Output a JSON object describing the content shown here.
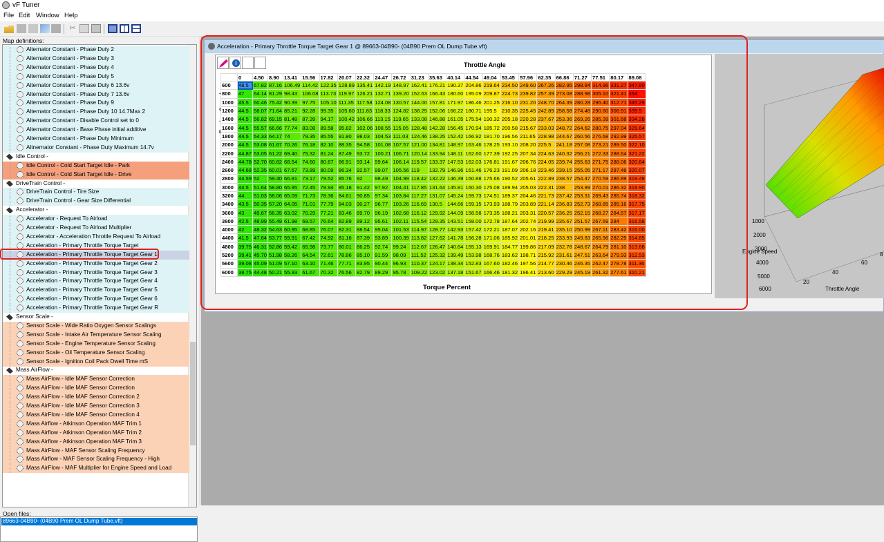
{
  "app": {
    "title": "vF Tuner"
  },
  "menu": [
    "File",
    "Edit",
    "Window",
    "Help"
  ],
  "left": {
    "map_label": "Map definitions:",
    "open_label": "Open files:",
    "open_file": "89663-04B90- (04B90 Prem OL Dump Tube.vft)"
  },
  "tree": [
    {
      "t": "Alternator Constant - Phase Duty 2",
      "c": "alt",
      "k": "item"
    },
    {
      "t": "Alternator Constant - Phase Duty 3",
      "c": "alt",
      "k": "item"
    },
    {
      "t": "Alternator Constant - Phase Duty 4",
      "c": "alt",
      "k": "item"
    },
    {
      "t": "Alternator Constant - Phase Duty 5",
      "c": "alt",
      "k": "item"
    },
    {
      "t": "Alternator Constant - Phase Duty 6 13.6v",
      "c": "alt",
      "k": "item"
    },
    {
      "t": "Alternator Constant - Phase Duty 7 13.6v",
      "c": "alt",
      "k": "item"
    },
    {
      "t": "Alternator Constant - Phase Duty 9",
      "c": "alt",
      "k": "item"
    },
    {
      "t": "Alternator Constant - Phase Duty 10 14.7Max 2",
      "c": "alt",
      "k": "item"
    },
    {
      "t": "Alternator Constant - Disable Control set to 0",
      "c": "alt",
      "k": "item"
    },
    {
      "t": "Alternator Constant - Base Phase initial additive",
      "c": "alt",
      "k": "item"
    },
    {
      "t": "Alternator Constant - Phase Duty Minimum",
      "c": "alt",
      "k": "item"
    },
    {
      "t": "Altnernator Constant - Phase Duty Maximum 14.7v",
      "c": "alt",
      "k": "item"
    },
    {
      "t": "Idle Control -",
      "c": "",
      "k": "folder"
    },
    {
      "t": "Idle Control - Cold Start Target Idle - Park",
      "c": "idle",
      "k": "item"
    },
    {
      "t": "Idle Control - Cold Start Target Idle - Drive",
      "c": "idle",
      "k": "item"
    },
    {
      "t": "DriveTrain Control -",
      "c": "",
      "k": "folder"
    },
    {
      "t": "DriveTrain Control - Tire Size",
      "c": "drive",
      "k": "item"
    },
    {
      "t": "DriveTrain Control - Gear Size Differential",
      "c": "drive",
      "k": "item"
    },
    {
      "t": "Accelerator -",
      "c": "",
      "k": "folder"
    },
    {
      "t": "Accelerator - Request To Airload",
      "c": "accel",
      "k": "item"
    },
    {
      "t": "Accelerator - Request To Airload Multiplier",
      "c": "accel",
      "k": "item"
    },
    {
      "t": "Accelerator - Acceleration Throttle Request To Airload",
      "c": "accel",
      "k": "item"
    },
    {
      "t": "Acceleration - Primary Throttle Torque Target",
      "c": "accel",
      "k": "item"
    },
    {
      "t": "Acceleration - Primary Throttle Torque Target Gear 1",
      "c": "sel",
      "k": "item"
    },
    {
      "t": "Acceleration - Primary Throttle Torque Target Gear 2",
      "c": "accel",
      "k": "item"
    },
    {
      "t": "Acceleration - Primary Throttle Torque Target Gear 3",
      "c": "accel",
      "k": "item"
    },
    {
      "t": "Acceleration - Primary Throttle Torque Target Gear 4",
      "c": "accel",
      "k": "item"
    },
    {
      "t": "Acceleration - Primary Throttle Torque Target Gear 5",
      "c": "accel",
      "k": "item"
    },
    {
      "t": "Acceleration - Primary Throttle Torque Target Gear 6",
      "c": "accel",
      "k": "item"
    },
    {
      "t": "Acceleration - Primary Throttle Torque Target Gear R",
      "c": "accel",
      "k": "item"
    },
    {
      "t": "Sensor Scale -",
      "c": "",
      "k": "folder"
    },
    {
      "t": "Sensor Scale - Wide Ratio Oxygen Sensor Scalings",
      "c": "sensor",
      "k": "item"
    },
    {
      "t": "Sensor Scale - Intake Air Temperature Sensor Scaling",
      "c": "sensor",
      "k": "item"
    },
    {
      "t": "Sensor Scale - Engine Temperature Sensor Scaling",
      "c": "sensor",
      "k": "item"
    },
    {
      "t": "Sensor Scale - Oil Temperature Sensor Scaling",
      "c": "sensor",
      "k": "item"
    },
    {
      "t": "Sensor Scale - Ignition Coil Pack Dwell Time mS",
      "c": "sensor",
      "k": "item"
    },
    {
      "t": "Mass AirFlow -",
      "c": "",
      "k": "folder"
    },
    {
      "t": "Mass AirFlow - Idle MAF Sensor Correction",
      "c": "maf",
      "k": "item"
    },
    {
      "t": "Mass AirFlow - Idle MAF Sensor Correction",
      "c": "maf",
      "k": "item"
    },
    {
      "t": "Mass AirFlow - Idle MAF Sensor Correction 2",
      "c": "maf",
      "k": "item"
    },
    {
      "t": "Mass AirFlow - Idle MAF Sensor Correction 3",
      "c": "maf",
      "k": "item"
    },
    {
      "t": "Mass AirFlow - Idle MAF Sensor Correction 4",
      "c": "maf",
      "k": "item"
    },
    {
      "t": "Mass Airflow - Atkinson Operation MAF Trim 1",
      "c": "maf",
      "k": "item"
    },
    {
      "t": "Mass Airflow - Atkinson Operation MAF Trim 2",
      "c": "maf",
      "k": "item"
    },
    {
      "t": "Mass Airflow - Atkinson Operation MAF Trim 3",
      "c": "maf",
      "k": "item"
    },
    {
      "t": "Mass AirFlow - MAF Sensor Scaling Frequency",
      "c": "maf",
      "k": "item"
    },
    {
      "t": "Mass Airflow - MAF Sensor Scaling Frequency - High",
      "c": "maf",
      "k": "item"
    },
    {
      "t": "Mass AirFlow - MAF Multiplier for Engine Speed and Load",
      "c": "maf",
      "k": "item"
    }
  ],
  "editor": {
    "title": "Acceleration - Primary Throttle Torque Target Gear 1 @ 89663-04B90- (04B90 Prem OL Dump Tube.vft)",
    "x_title": "Throttle Angle",
    "y_title": "Engine Speed",
    "z_title": "Torque Percent",
    "info_glyph": "i",
    "cols": [
      "0",
      "4.50",
      "8.90",
      "13.41",
      "15.56",
      "17.82",
      "20.07",
      "22.32",
      "24.47",
      "26.72",
      "31.23",
      "35.63",
      "40.14",
      "44.54",
      "49.04",
      "53.45",
      "57.96",
      "62.35",
      "66.86",
      "71.27",
      "77.51",
      "80.17",
      "89.08"
    ],
    "rows": [
      {
        "rpm": "600",
        "v": [
          "48.5",
          "67.82",
          "87.16",
          "106.49",
          "114.42",
          "122.35",
          "128.89",
          "135.41",
          "142.19",
          "148.97",
          "162.41",
          "176.21",
          "190.37",
          "204.86",
          "219.64",
          "234.50",
          "249.60",
          "267.26",
          "282.95",
          "298.84",
          "314.96",
          "331.27",
          "347.80"
        ]
      },
      {
        "rpm": "800",
        "v": [
          "47",
          "64.14",
          "81.29",
          "98.43",
          "106.08",
          "113.73",
          "119.97",
          "126.21",
          "132.71",
          "139.20",
          "152.63",
          "166.43",
          "180.60",
          "195.09",
          "209.87",
          "224.73",
          "239.82",
          "257.39",
          "273.08",
          "288.98",
          "305.10",
          "321.41",
          "354"
        ]
      },
      {
        "rpm": "1000",
        "v": [
          "45.5",
          "60.46",
          "75.42",
          "90.39",
          "97.75",
          "105.10",
          "111.35",
          "117.58",
          "124.08",
          "130.57",
          "144.00",
          "157.81",
          "171.97",
          "186.46",
          "201.25",
          "216.10",
          "231.20",
          "248.70",
          "264.39",
          "280.28",
          "296.40",
          "312.71",
          "345.29"
        ]
      },
      {
        "rpm": "1200",
        "v": [
          "44.5",
          "58.07",
          "71.64",
          "85.21",
          "92.28",
          "99.35",
          "105.60",
          "111.83",
          "118.33",
          "124.82",
          "138.25",
          "152.06",
          "166.22",
          "180.71",
          "195.5",
          "210.35",
          "225.45",
          "242.89",
          "258.58",
          "274.48",
          "290.60",
          "306.91",
          "339.5"
        ]
      },
      {
        "rpm": "1400",
        "v": [
          "44.5",
          "56.82",
          "69.15",
          "81.48",
          "87.39",
          "94.17",
          "100.42",
          "106.66",
          "113.15",
          "119.65",
          "133.08",
          "146.88",
          "161.05",
          "175.54",
          "190.32",
          "205.18",
          "220.28",
          "237.67",
          "253.36",
          "269.26",
          "285.39",
          "301.68",
          "334.28"
        ]
      },
      {
        "rpm": "1600",
        "v": [
          "44.5",
          "55.57",
          "66.66",
          "77.74",
          "83.08",
          "89.58",
          "95.82",
          "102.06",
          "108.55",
          "115.05",
          "128.48",
          "142.28",
          "156.45",
          "170.94",
          "185.72",
          "200.58",
          "215.67",
          "233.03",
          "248.72",
          "264.62",
          "280.75",
          "297.04",
          "329.64"
        ]
      },
      {
        "rpm": "1800",
        "v": [
          "44.5",
          "54.33",
          "64.17",
          "74",
          "79.35",
          "85.55",
          "91.80",
          "98.03",
          "104.53",
          "111.03",
          "124.46",
          "138.25",
          "152.42",
          "166.92",
          "181.70",
          "196.56",
          "211.65",
          "228.98",
          "244.67",
          "260.56",
          "276.68",
          "292.99",
          "325.57"
        ]
      },
      {
        "rpm": "2000",
        "v": [
          "44.5",
          "53.08",
          "61.67",
          "70.26",
          "76.18",
          "82.10",
          "88.35",
          "94.58",
          "101.08",
          "107.57",
          "121.00",
          "134.81",
          "148.97",
          "163.46",
          "178.25",
          "193.10",
          "208.20",
          "225.5",
          "241.18",
          "257.08",
          "273.21",
          "289.50",
          "322.10"
        ]
      },
      {
        "rpm": "2200",
        "v": [
          "44.87",
          "53.05",
          "61.22",
          "69.40",
          "75.32",
          "81.24",
          "87.49",
          "93.72",
          "100.21",
          "106.71",
          "120.14",
          "133.94",
          "148.11",
          "162.60",
          "177.39",
          "192.25",
          "207.34",
          "224.63",
          "240.32",
          "256.21",
          "272.33",
          "288.64",
          "321.22"
        ]
      },
      {
        "rpm": "2400",
        "v": [
          "44.78",
          "52.70",
          "60.62",
          "68.54",
          "74.60",
          "80.67",
          "86.91",
          "93.14",
          "99.64",
          "106.14",
          "119.57",
          "133.37",
          "147.53",
          "162.03",
          "176.81",
          "191.67",
          "206.76",
          "224.05",
          "239.74",
          "255.63",
          "271.75",
          "288.06",
          "320.64"
        ]
      },
      {
        "rpm": "2600",
        "v": [
          "44.68",
          "52.35",
          "60.01",
          "67.67",
          "73.89",
          "80.09",
          "86.34",
          "92.57",
          "99.07",
          "105.56",
          "119",
          "132.79",
          "146.96",
          "161.46",
          "176.23",
          "191.09",
          "206.18",
          "223.46",
          "239.15",
          "255.05",
          "271.17",
          "287.48",
          "320.07"
        ]
      },
      {
        "rpm": "2800",
        "v": [
          "44.59",
          "52",
          "59.40",
          "66.81",
          "73.17",
          "79.52",
          "85.76",
          "92",
          "98.49",
          "104.99",
          "118.42",
          "132.22",
          "146.39",
          "160.88",
          "175.66",
          "190.52",
          "205.61",
          "222.89",
          "238.57",
          "254.47",
          "270.59",
          "286.89",
          "319.49"
        ]
      },
      {
        "rpm": "3000",
        "v": [
          "44.5",
          "51.64",
          "58.80",
          "65.95",
          "72.45",
          "78.94",
          "85.18",
          "91.42",
          "97.92",
          "104.41",
          "117.85",
          "131.64",
          "145.81",
          "160.30",
          "175.08",
          "189.94",
          "205.03",
          "222.31",
          "238",
          "253.89",
          "270.01",
          "286.32",
          "318.90"
        ]
      },
      {
        "rpm": "3200",
        "v": [
          "44",
          "51.03",
          "58.06",
          "65.09",
          "71.73",
          "78.36",
          "84.61",
          "90.85",
          "97.34",
          "103.84",
          "117.27",
          "131.07",
          "145.24",
          "159.73",
          "174.51",
          "189.37",
          "204.46",
          "221.73",
          "237.42",
          "253.31",
          "269.43",
          "285.74",
          "318.32"
        ]
      },
      {
        "rpm": "3400",
        "v": [
          "43.5",
          "50.35",
          "57.20",
          "64.05",
          "71.01",
          "77.79",
          "84.03",
          "90.27",
          "96.77",
          "103.26",
          "116.69",
          "130.5",
          "144.66",
          "159.15",
          "173.93",
          "188.79",
          "203.89",
          "221.14",
          "236.83",
          "252.73",
          "268.85",
          "285.16",
          "317.75"
        ]
      },
      {
        "rpm": "3600",
        "v": [
          "43",
          "49.67",
          "56.35",
          "63.02",
          "70.29",
          "77.21",
          "83.46",
          "89.70",
          "96.19",
          "102.68",
          "116.12",
          "129.92",
          "144.09",
          "158.58",
          "173.35",
          "188.21",
          "203.31",
          "220.57",
          "236.25",
          "252.15",
          "268.27",
          "284.57",
          "317.17"
        ]
      },
      {
        "rpm": "3800",
        "v": [
          "42.5",
          "48.99",
          "55.49",
          "61.98",
          "69.57",
          "76.64",
          "82.89",
          "89.12",
          "95.61",
          "102.11",
          "115.54",
          "129.35",
          "143.51",
          "158.00",
          "172.78",
          "187.64",
          "202.74",
          "219.99",
          "235.67",
          "251.57",
          "267.69",
          "284",
          "316.58"
        ]
      },
      {
        "rpm": "4000",
        "v": [
          "42",
          "48.32",
          "54.63",
          "60.95",
          "68.85",
          "76.07",
          "82.31",
          "88.54",
          "95.04",
          "101.53",
          "114.97",
          "128.77",
          "142.93",
          "157.42",
          "172.21",
          "187.07",
          "202.16",
          "219.41",
          "235.10",
          "250.99",
          "267.11",
          "283.42",
          "316.00"
        ]
      },
      {
        "rpm": "4400",
        "v": [
          "41.5",
          "47.64",
          "53.77",
          "59.91",
          "67.42",
          "74.92",
          "81.16",
          "87.39",
          "93.89",
          "100.39",
          "113.82",
          "127.62",
          "141.78",
          "156.28",
          "171.06",
          "185.92",
          "201.01",
          "218.25",
          "233.93",
          "249.83",
          "265.96",
          "282.25",
          "314.85"
        ]
      },
      {
        "rpm": "4800",
        "v": [
          "39.75",
          "46.31",
          "52.86",
          "59.42",
          "65.98",
          "73.77",
          "80.01",
          "86.25",
          "92.74",
          "99.24",
          "112.67",
          "126.47",
          "140.64",
          "155.13",
          "169.91",
          "184.77",
          "199.86",
          "217.09",
          "232.78",
          "248.67",
          "264.79",
          "281.10",
          "313.68"
        ]
      },
      {
        "rpm": "5200",
        "v": [
          "39.41",
          "45.70",
          "51.98",
          "58.26",
          "64.54",
          "72.61",
          "78.86",
          "85.10",
          "91.59",
          "98.09",
          "111.52",
          "125.32",
          "139.49",
          "153.98",
          "168.76",
          "183.62",
          "198.71",
          "215.92",
          "231.61",
          "247.51",
          "263.64",
          "279.93",
          "312.53"
        ]
      },
      {
        "rpm": "5600",
        "v": [
          "39.08",
          "45.09",
          "51.09",
          "57.10",
          "63.10",
          "71.46",
          "77.71",
          "83.95",
          "90.44",
          "96.93",
          "110.37",
          "124.17",
          "138.34",
          "152.83",
          "167.60",
          "182.46",
          "197.56",
          "214.77",
          "230.46",
          "246.35",
          "262.47",
          "278.78",
          "311.36"
        ]
      },
      {
        "rpm": "6000",
        "v": [
          "38.75",
          "44.48",
          "50.21",
          "55.93",
          "61.67",
          "70.32",
          "76.56",
          "82.79",
          "89.29",
          "95.78",
          "109.22",
          "123.02",
          "137.18",
          "151.67",
          "166.46",
          "181.32",
          "196.41",
          "213.60",
          "229.29",
          "245.19",
          "261.32",
          "277.61",
          "310.21"
        ]
      }
    ]
  },
  "plot": {
    "y_ticks": [
      "1000",
      "2000",
      "3000",
      "4000",
      "5000",
      "6000"
    ],
    "x_ticks": [
      "20",
      "40",
      "60",
      "8"
    ],
    "y_label": "Engine Speed",
    "x_label": "Throttle Angle"
  }
}
